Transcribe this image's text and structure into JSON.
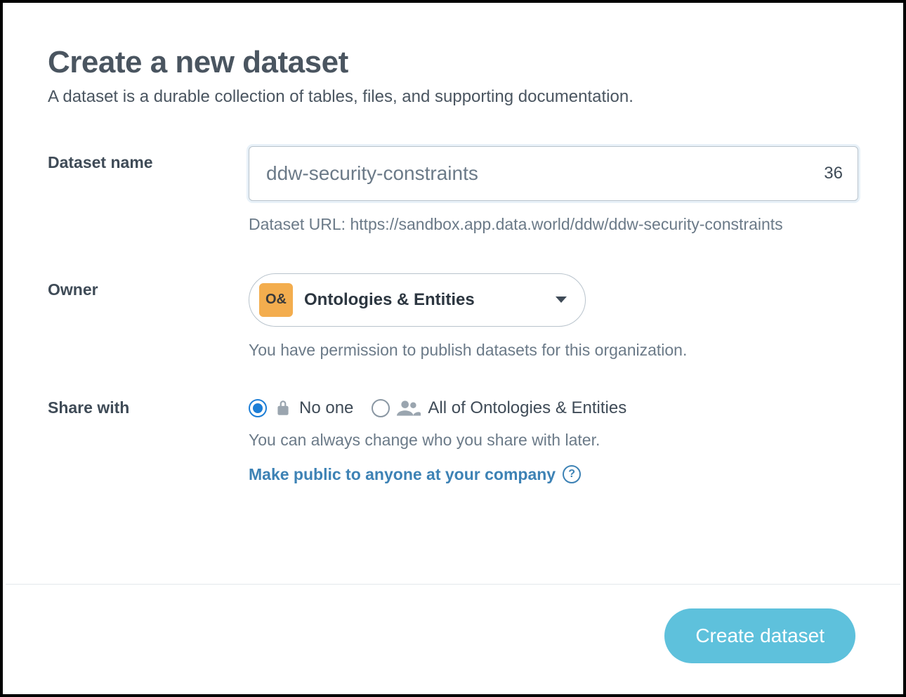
{
  "header": {
    "title": "Create a new dataset",
    "subtitle": "A dataset is a durable collection of tables, files, and supporting documentation."
  },
  "name_field": {
    "label": "Dataset name",
    "value": "ddw-security-constraints",
    "remaining": "36",
    "url_hint": "Dataset URL: https://sandbox.app.data.world/ddw/ddw-security-constraints"
  },
  "owner_field": {
    "label": "Owner",
    "avatar_text": "O&",
    "selected": "Ontologies & Entities",
    "hint": "You have permission to publish datasets for this organization."
  },
  "share_field": {
    "label": "Share with",
    "option_none": "No one",
    "option_all": "All of Ontologies & Entities",
    "hint": "You can always change who you share with later.",
    "public_link": "Make public to anyone at your company"
  },
  "footer": {
    "create_label": "Create dataset"
  }
}
